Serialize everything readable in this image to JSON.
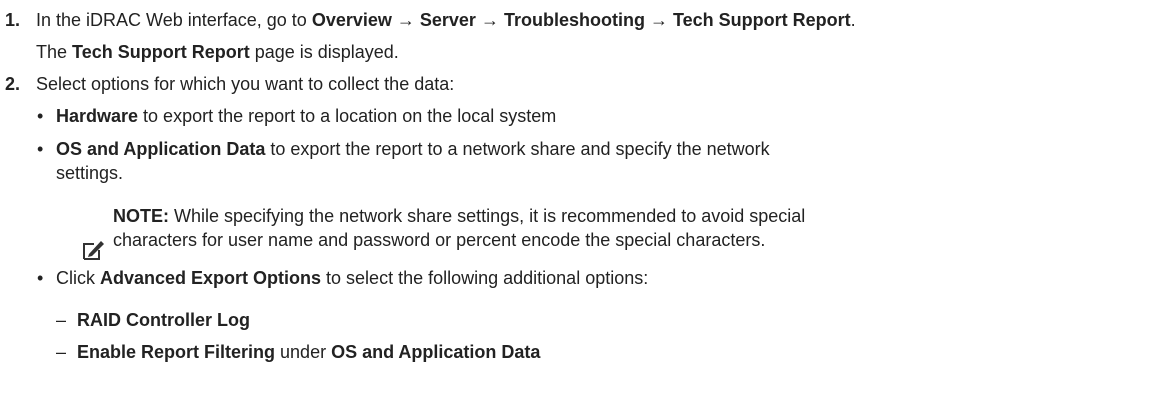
{
  "steps": [
    {
      "number": "1.",
      "text_parts": [
        "In the iDRAC Web interface, go to ",
        "Overview",
        " → ",
        "Server",
        " → ",
        "Troubleshooting",
        " → ",
        "Tech Support Report",
        "."
      ],
      "result_parts": [
        "The ",
        "Tech Support Report",
        " page is displayed."
      ]
    },
    {
      "number": "2.",
      "text": "Select options for which you want to collect the data:"
    }
  ],
  "bullets": [
    {
      "bold": "Hardware",
      "text": " to export the report to a location on the local system"
    },
    {
      "bold": "OS and Application Data",
      "text": " to export the report to a network share and specify the network",
      "text_cont": "settings."
    },
    {
      "prefix": "Click ",
      "bold": "Advanced Export Options",
      "text": " to select the following additional options:"
    }
  ],
  "note": {
    "icon": "note-pencil-icon",
    "label": "NOTE:",
    "text": " While specifying the network share settings, it is recommended to avoid special",
    "text_cont": "characters for user name and password or percent encode the special characters."
  },
  "sub_options": [
    {
      "bold": "RAID Controller Log"
    },
    {
      "bold": "Enable Report Filtering",
      "text": " under ",
      "bold2": "OS and Application Data"
    }
  ]
}
